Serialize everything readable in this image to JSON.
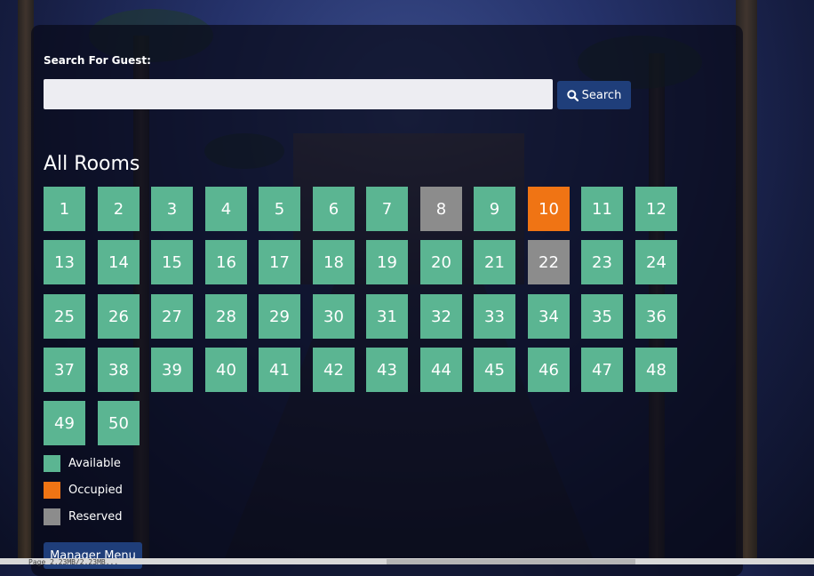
{
  "search": {
    "label": "Search For Guest:",
    "placeholder": "",
    "value": "",
    "button_label": "Search",
    "button_icon": "search-icon"
  },
  "rooms_title": "All Rooms",
  "colors": {
    "available": "#5bb592",
    "occupied": "#f07414",
    "reserved": "#8c8c8c",
    "button": "#1f3e7a"
  },
  "rooms": [
    {
      "number": "1",
      "status": "available"
    },
    {
      "number": "2",
      "status": "available"
    },
    {
      "number": "3",
      "status": "available"
    },
    {
      "number": "4",
      "status": "available"
    },
    {
      "number": "5",
      "status": "available"
    },
    {
      "number": "6",
      "status": "available"
    },
    {
      "number": "7",
      "status": "available"
    },
    {
      "number": "8",
      "status": "reserved"
    },
    {
      "number": "9",
      "status": "available"
    },
    {
      "number": "10",
      "status": "occupied"
    },
    {
      "number": "11",
      "status": "available"
    },
    {
      "number": "12",
      "status": "available"
    },
    {
      "number": "13",
      "status": "available"
    },
    {
      "number": "14",
      "status": "available"
    },
    {
      "number": "15",
      "status": "available"
    },
    {
      "number": "16",
      "status": "available"
    },
    {
      "number": "17",
      "status": "available"
    },
    {
      "number": "18",
      "status": "available"
    },
    {
      "number": "19",
      "status": "available"
    },
    {
      "number": "20",
      "status": "available"
    },
    {
      "number": "21",
      "status": "available"
    },
    {
      "number": "22",
      "status": "reserved"
    },
    {
      "number": "23",
      "status": "available"
    },
    {
      "number": "24",
      "status": "available"
    },
    {
      "number": "25",
      "status": "available"
    },
    {
      "number": "26",
      "status": "available"
    },
    {
      "number": "27",
      "status": "available"
    },
    {
      "number": "28",
      "status": "available"
    },
    {
      "number": "29",
      "status": "available"
    },
    {
      "number": "30",
      "status": "available"
    },
    {
      "number": "31",
      "status": "available"
    },
    {
      "number": "32",
      "status": "available"
    },
    {
      "number": "33",
      "status": "available"
    },
    {
      "number": "34",
      "status": "available"
    },
    {
      "number": "35",
      "status": "available"
    },
    {
      "number": "36",
      "status": "available"
    },
    {
      "number": "37",
      "status": "available"
    },
    {
      "number": "38",
      "status": "available"
    },
    {
      "number": "39",
      "status": "available"
    },
    {
      "number": "40",
      "status": "available"
    },
    {
      "number": "41",
      "status": "available"
    },
    {
      "number": "42",
      "status": "available"
    },
    {
      "number": "43",
      "status": "available"
    },
    {
      "number": "44",
      "status": "available"
    },
    {
      "number": "45",
      "status": "available"
    },
    {
      "number": "46",
      "status": "available"
    },
    {
      "number": "47",
      "status": "available"
    },
    {
      "number": "48",
      "status": "available"
    },
    {
      "number": "49",
      "status": "available"
    },
    {
      "number": "50",
      "status": "available"
    }
  ],
  "legend": [
    {
      "label": "Available",
      "status": "available"
    },
    {
      "label": "Occupied",
      "status": "occupied"
    },
    {
      "label": "Reserved",
      "status": "reserved"
    }
  ],
  "manager_button_label": "Manager Menu",
  "status_bar_text": "Page 2.23MB/2.23MB..."
}
